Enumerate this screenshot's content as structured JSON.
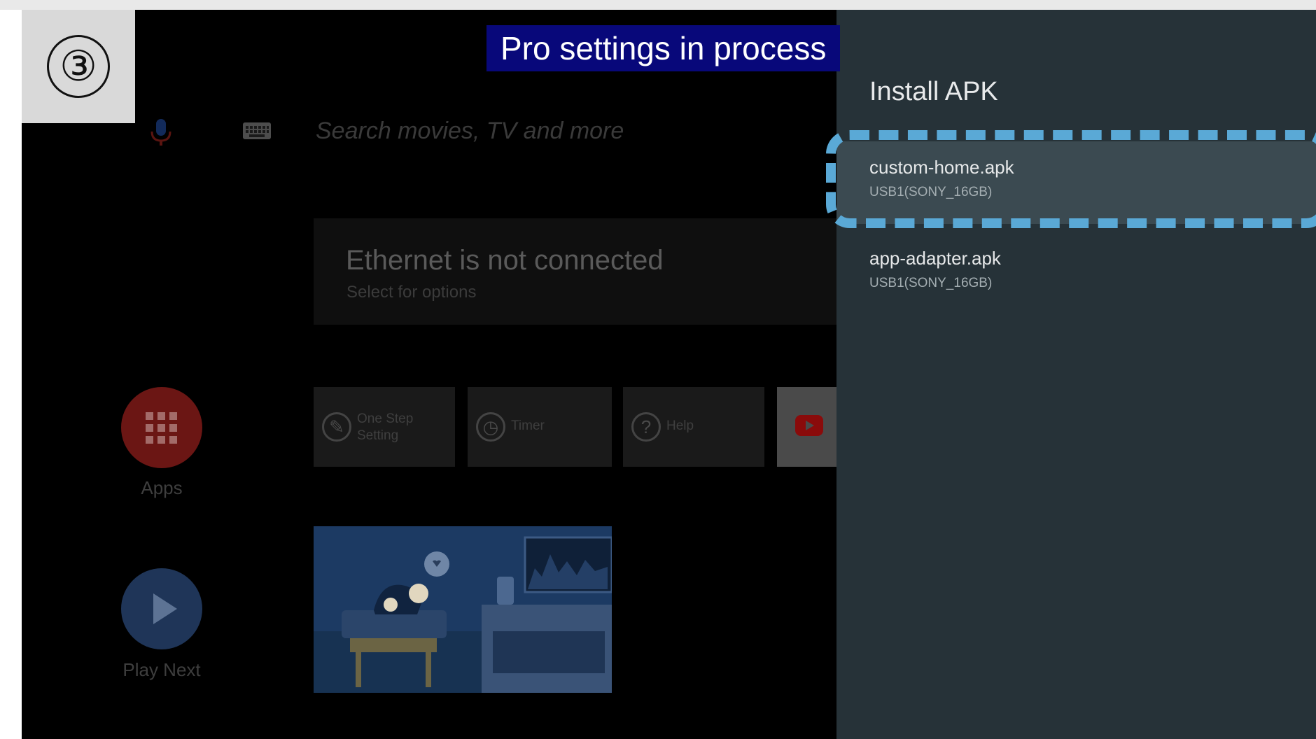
{
  "step": {
    "number": "③"
  },
  "banner": {
    "text": "Pro settings in process"
  },
  "home": {
    "search_placeholder": "Search movies, TV and more",
    "network_card": {
      "title": "Ethernet is not connected",
      "subtitle": "Select for options"
    },
    "apps_label": "Apps",
    "play_next_label": "Play Next",
    "tiles": [
      {
        "label": "One Step Setting",
        "icon": "wrench-icon"
      },
      {
        "label": "Timer",
        "icon": "clock-icon"
      },
      {
        "label": "Help",
        "icon": "help-icon"
      },
      {
        "label": "",
        "icon": "youtube-icon"
      }
    ]
  },
  "panel": {
    "title": "Install APK",
    "items": [
      {
        "name": "custom-home.apk",
        "source": "USB1(SONY_16GB)"
      },
      {
        "name": "app-adapter.apk",
        "source": "USB1(SONY_16GB)"
      }
    ]
  },
  "colors": {
    "panel_bg": "#263238",
    "selected_bg": "#3b4a51",
    "highlight_dash": "#5aa9d6",
    "banner_bg": "#08087a"
  }
}
